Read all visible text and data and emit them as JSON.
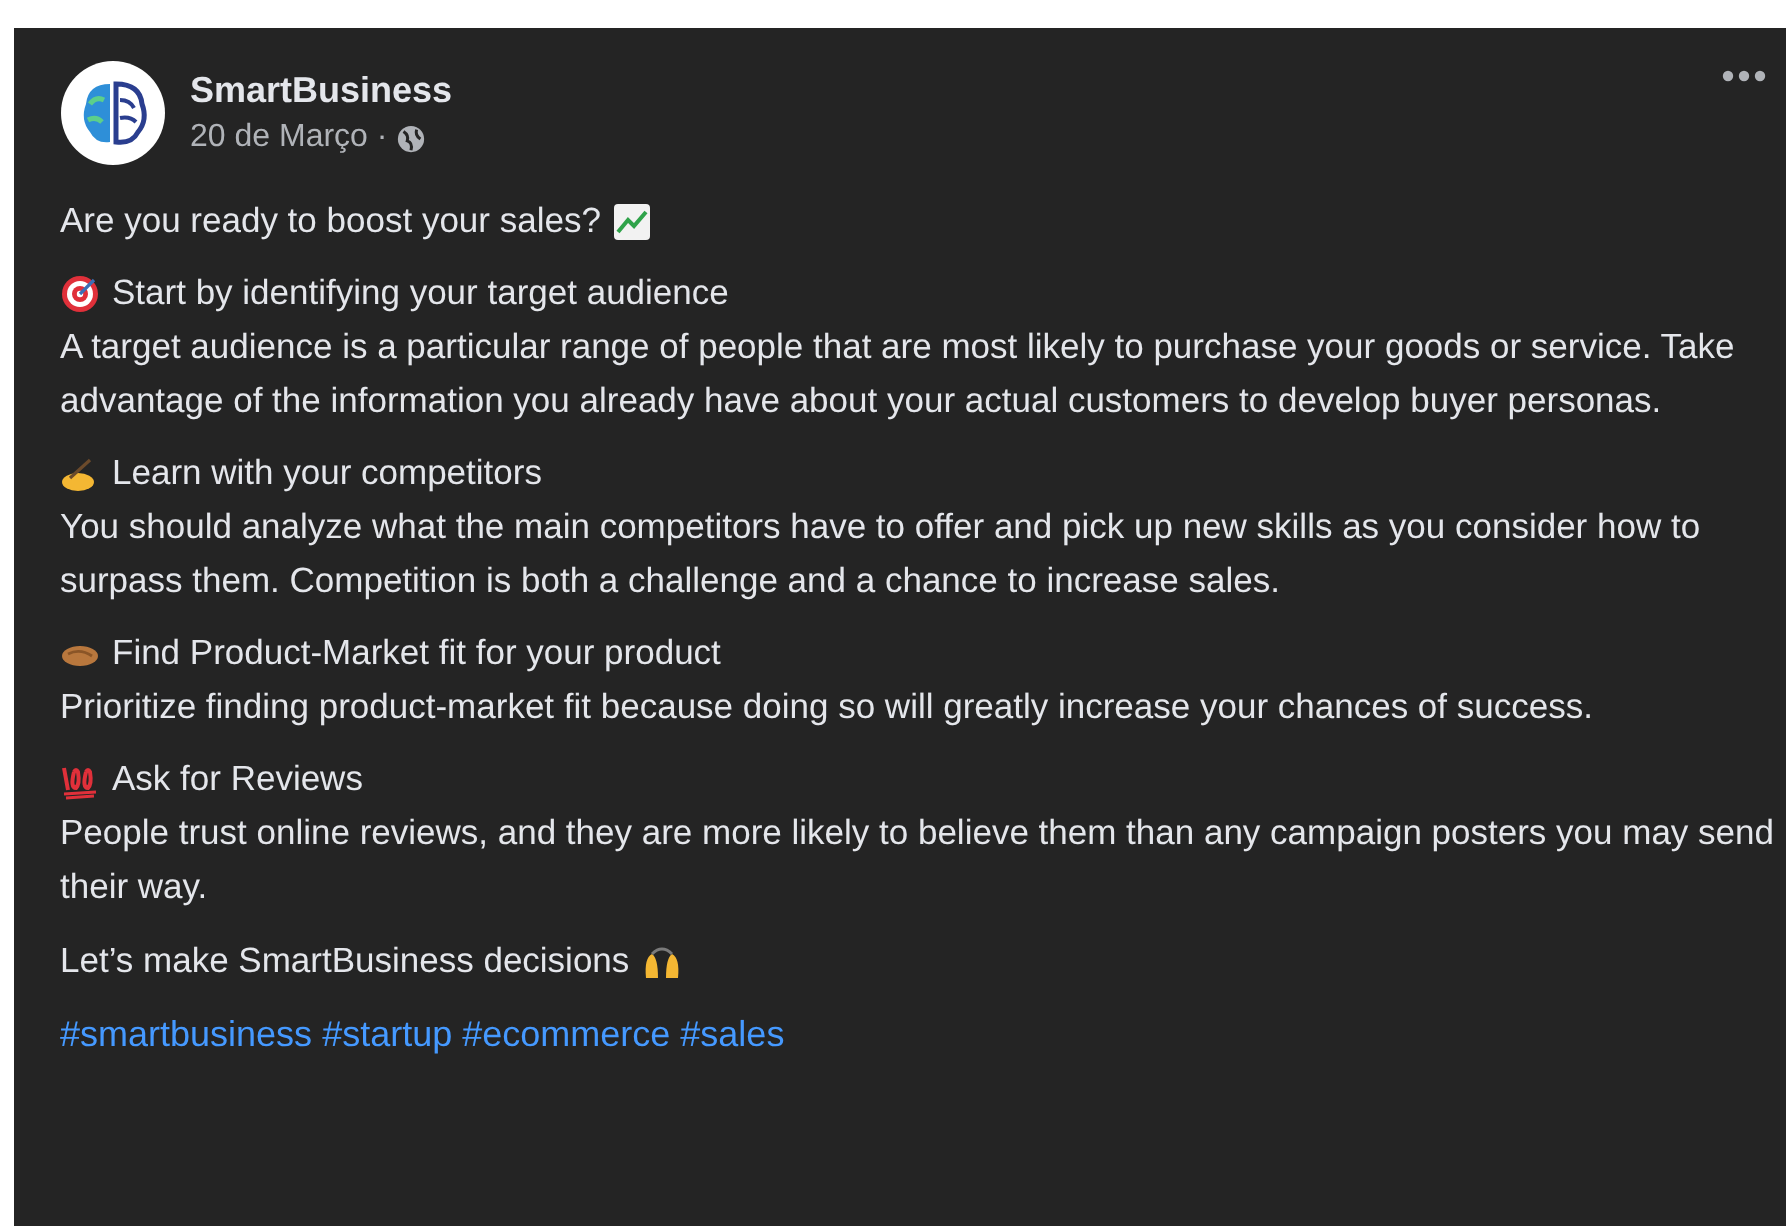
{
  "post": {
    "author": "SmartBusiness",
    "date": "20 de Março ·",
    "intro": "Are you ready to boost your sales?",
    "sections": [
      {
        "heading": "Start by identifying your target audience",
        "body": "A target audience is a particular range of people that are most likely to purchase your goods or service. Take advantage of the information you already have about your actual customers to develop buyer personas."
      },
      {
        "heading": "Learn with your competitors",
        "body": "You should analyze what the main competitors have to offer and pick up new skills as you consider how to surpass them. Competition is both a challenge and a chance to increase sales."
      },
      {
        "heading": "Find Product-Market fit for your product",
        "body": "Prioritize finding product-market fit because doing so will greatly increase your chances of success."
      },
      {
        "heading": "Ask for Reviews",
        "body": "People trust online reviews, and they are more likely to believe them than any campaign posters you may send their way."
      }
    ],
    "closing": "Let’s make SmartBusiness decisions",
    "hashtags": [
      "#smartbusiness",
      "#startup",
      "#ecommerce",
      "#sales"
    ]
  }
}
